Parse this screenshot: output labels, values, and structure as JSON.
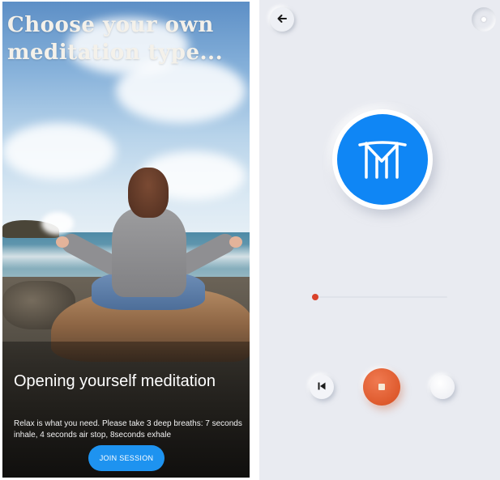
{
  "left_screen": {
    "headline": "Choose your own meditation type...",
    "session_title": "Opening yourself meditation",
    "session_description": "Relax is what you need. Please take 3 deep breaths: 7 seconds inhale, 4 seconds air stop, 8seconds exhale",
    "join_button_label": "JOIN SESSION",
    "background_image": "woman-meditating-on-seaside-rock"
  },
  "right_screen": {
    "back_icon": "arrow-left-icon",
    "settings_icon": "dot-button-icon",
    "logo_icon": "m-logo-icon",
    "playback_progress": 0.02,
    "controls": {
      "previous_icon": "skip-previous-icon",
      "stop_icon": "stop-icon",
      "next_icon": "blank-circle-button"
    }
  },
  "colors": {
    "accent_blue": "#1e93f0",
    "logo_blue": "#0f86f5",
    "stop_orange": "#de5a2d",
    "progress_red": "#d9412a",
    "panel_background": "#e9ebf1"
  }
}
